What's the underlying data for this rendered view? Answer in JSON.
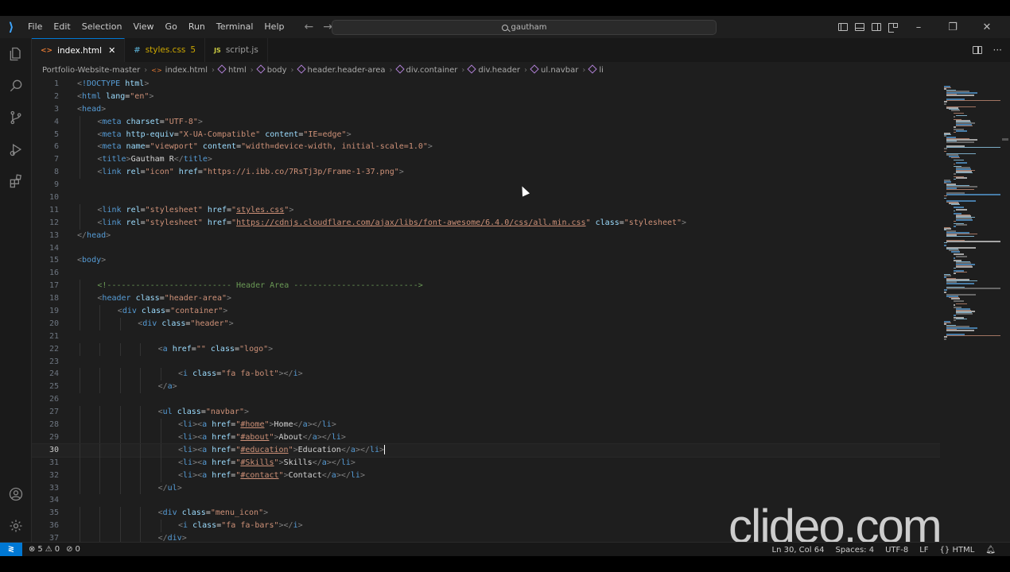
{
  "menu": [
    "File",
    "Edit",
    "Selection",
    "View",
    "Go",
    "Run",
    "Terminal",
    "Help"
  ],
  "search": {
    "text": "gautham"
  },
  "tabs": [
    {
      "icon": "<>",
      "label": "index.html",
      "modified": "",
      "active": true
    },
    {
      "icon": "#",
      "label": "styles.css",
      "modified": "5",
      "active": false
    },
    {
      "icon": "JS",
      "label": "script.js",
      "modified": "",
      "active": false
    }
  ],
  "breadcrumb": [
    "Portfolio-Website-master",
    "index.html",
    "html",
    "body",
    "header.header-area",
    "div.container",
    "div.header",
    "ul.navbar",
    "li"
  ],
  "current_line": 30,
  "code_lines": [
    {
      "n": 1,
      "indent": 0,
      "parts": [
        [
          "p",
          "<"
        ],
        [
          "t",
          "!DOCTYPE"
        ],
        [
          "x",
          " "
        ],
        [
          "a",
          "html"
        ],
        [
          "p",
          ">"
        ]
      ]
    },
    {
      "n": 2,
      "indent": 0,
      "parts": [
        [
          "p",
          "<"
        ],
        [
          "t",
          "html"
        ],
        [
          "x",
          " "
        ],
        [
          "a",
          "lang"
        ],
        [
          "x",
          "="
        ],
        [
          "s",
          "\"en\""
        ],
        [
          "p",
          ">"
        ]
      ]
    },
    {
      "n": 3,
      "indent": 0,
      "parts": [
        [
          "p",
          "<"
        ],
        [
          "t",
          "head"
        ],
        [
          "p",
          ">"
        ]
      ]
    },
    {
      "n": 4,
      "indent": 1,
      "parts": [
        [
          "p",
          "<"
        ],
        [
          "t",
          "meta"
        ],
        [
          "x",
          " "
        ],
        [
          "a",
          "charset"
        ],
        [
          "x",
          "="
        ],
        [
          "s",
          "\"UTF-8\""
        ],
        [
          "p",
          ">"
        ]
      ]
    },
    {
      "n": 5,
      "indent": 1,
      "parts": [
        [
          "p",
          "<"
        ],
        [
          "t",
          "meta"
        ],
        [
          "x",
          " "
        ],
        [
          "a",
          "http-equiv"
        ],
        [
          "x",
          "="
        ],
        [
          "s",
          "\"X-UA-Compatible\""
        ],
        [
          "x",
          " "
        ],
        [
          "a",
          "content"
        ],
        [
          "x",
          "="
        ],
        [
          "s",
          "\"IE=edge\""
        ],
        [
          "p",
          ">"
        ]
      ]
    },
    {
      "n": 6,
      "indent": 1,
      "parts": [
        [
          "p",
          "<"
        ],
        [
          "t",
          "meta"
        ],
        [
          "x",
          " "
        ],
        [
          "a",
          "name"
        ],
        [
          "x",
          "="
        ],
        [
          "s",
          "\"viewport\""
        ],
        [
          "x",
          " "
        ],
        [
          "a",
          "content"
        ],
        [
          "x",
          "="
        ],
        [
          "s",
          "\"width=device-width, initial-scale=1.0\""
        ],
        [
          "p",
          ">"
        ]
      ]
    },
    {
      "n": 7,
      "indent": 1,
      "parts": [
        [
          "p",
          "<"
        ],
        [
          "t",
          "title"
        ],
        [
          "p",
          ">"
        ],
        [
          "x",
          "Gautham R"
        ],
        [
          "p",
          "</"
        ],
        [
          "t",
          "title"
        ],
        [
          "p",
          ">"
        ]
      ]
    },
    {
      "n": 8,
      "indent": 1,
      "parts": [
        [
          "p",
          "<"
        ],
        [
          "t",
          "link"
        ],
        [
          "x",
          " "
        ],
        [
          "a",
          "rel"
        ],
        [
          "x",
          "="
        ],
        [
          "s",
          "\"icon\""
        ],
        [
          "x",
          " "
        ],
        [
          "a",
          "href"
        ],
        [
          "x",
          "="
        ],
        [
          "s",
          "\"https://i.ibb.co/7RsTj3p/Frame-1-37.png\""
        ],
        [
          "p",
          ">"
        ]
      ]
    },
    {
      "n": 9,
      "indent": 0,
      "parts": []
    },
    {
      "n": 10,
      "indent": 0,
      "parts": []
    },
    {
      "n": 11,
      "indent": 1,
      "parts": [
        [
          "p",
          "<"
        ],
        [
          "t",
          "link"
        ],
        [
          "x",
          " "
        ],
        [
          "a",
          "rel"
        ],
        [
          "x",
          "="
        ],
        [
          "s",
          "\"stylesheet\""
        ],
        [
          "x",
          " "
        ],
        [
          "a",
          "href"
        ],
        [
          "x",
          "="
        ],
        [
          "s",
          "\""
        ],
        [
          "u",
          "styles.css"
        ],
        [
          "s",
          "\""
        ],
        [
          "p",
          ">"
        ]
      ]
    },
    {
      "n": 12,
      "indent": 1,
      "parts": [
        [
          "p",
          "<"
        ],
        [
          "t",
          "link"
        ],
        [
          "x",
          " "
        ],
        [
          "a",
          "rel"
        ],
        [
          "x",
          "="
        ],
        [
          "s",
          "\"stylesheet\""
        ],
        [
          "x",
          " "
        ],
        [
          "a",
          "href"
        ],
        [
          "x",
          "="
        ],
        [
          "s",
          "\""
        ],
        [
          "u",
          "https://cdnjs.cloudflare.com/ajax/libs/font-awesome/6.4.0/css/all.min.css"
        ],
        [
          "s",
          "\""
        ],
        [
          "x",
          " "
        ],
        [
          "a",
          "class"
        ],
        [
          "x",
          "="
        ],
        [
          "s",
          "\"stylesheet\""
        ],
        [
          "p",
          ">"
        ]
      ]
    },
    {
      "n": 13,
      "indent": 0,
      "parts": [
        [
          "p",
          "</"
        ],
        [
          "t",
          "head"
        ],
        [
          "p",
          ">"
        ]
      ]
    },
    {
      "n": 14,
      "indent": 0,
      "parts": []
    },
    {
      "n": 15,
      "indent": 0,
      "parts": [
        [
          "p",
          "<"
        ],
        [
          "t",
          "body"
        ],
        [
          "p",
          ">"
        ]
      ]
    },
    {
      "n": 16,
      "indent": 0,
      "parts": []
    },
    {
      "n": 17,
      "indent": 1,
      "parts": [
        [
          "c",
          "<!-------------------------- Header Area -------------------------->"
        ]
      ]
    },
    {
      "n": 18,
      "indent": 1,
      "parts": [
        [
          "p",
          "<"
        ],
        [
          "t",
          "header"
        ],
        [
          "x",
          " "
        ],
        [
          "a",
          "class"
        ],
        [
          "x",
          "="
        ],
        [
          "s",
          "\"header-area\""
        ],
        [
          "p",
          ">"
        ]
      ]
    },
    {
      "n": 19,
      "indent": 2,
      "parts": [
        [
          "p",
          "<"
        ],
        [
          "t",
          "div"
        ],
        [
          "x",
          " "
        ],
        [
          "a",
          "class"
        ],
        [
          "x",
          "="
        ],
        [
          "s",
          "\"container\""
        ],
        [
          "p",
          ">"
        ]
      ]
    },
    {
      "n": 20,
      "indent": 3,
      "parts": [
        [
          "p",
          "<"
        ],
        [
          "t",
          "div"
        ],
        [
          "x",
          " "
        ],
        [
          "a",
          "class"
        ],
        [
          "x",
          "="
        ],
        [
          "s",
          "\"header\""
        ],
        [
          "p",
          ">"
        ]
      ]
    },
    {
      "n": 21,
      "indent": 0,
      "parts": []
    },
    {
      "n": 22,
      "indent": 4,
      "parts": [
        [
          "p",
          "<"
        ],
        [
          "t",
          "a"
        ],
        [
          "x",
          " "
        ],
        [
          "a",
          "href"
        ],
        [
          "x",
          "="
        ],
        [
          "s",
          "\"\""
        ],
        [
          "x",
          " "
        ],
        [
          "a",
          "class"
        ],
        [
          "x",
          "="
        ],
        [
          "s",
          "\"logo\""
        ],
        [
          "p",
          ">"
        ]
      ]
    },
    {
      "n": 23,
      "indent": 0,
      "parts": []
    },
    {
      "n": 24,
      "indent": 5,
      "parts": [
        [
          "p",
          "<"
        ],
        [
          "t",
          "i"
        ],
        [
          "x",
          " "
        ],
        [
          "a",
          "class"
        ],
        [
          "x",
          "="
        ],
        [
          "s",
          "\"fa fa-bolt\""
        ],
        [
          "p",
          ">"
        ],
        [
          "p",
          "</"
        ],
        [
          "t",
          "i"
        ],
        [
          "p",
          ">"
        ]
      ]
    },
    {
      "n": 25,
      "indent": 4,
      "parts": [
        [
          "p",
          "</"
        ],
        [
          "t",
          "a"
        ],
        [
          "p",
          ">"
        ]
      ]
    },
    {
      "n": 26,
      "indent": 0,
      "parts": []
    },
    {
      "n": 27,
      "indent": 4,
      "parts": [
        [
          "p",
          "<"
        ],
        [
          "t",
          "ul"
        ],
        [
          "x",
          " "
        ],
        [
          "a",
          "class"
        ],
        [
          "x",
          "="
        ],
        [
          "s",
          "\"navbar\""
        ],
        [
          "p",
          ">"
        ]
      ]
    },
    {
      "n": 28,
      "indent": 5,
      "parts": [
        [
          "p",
          "<"
        ],
        [
          "t",
          "li"
        ],
        [
          "p",
          ">"
        ],
        [
          "p",
          "<"
        ],
        [
          "t",
          "a"
        ],
        [
          "x",
          " "
        ],
        [
          "a",
          "href"
        ],
        [
          "x",
          "="
        ],
        [
          "s",
          "\""
        ],
        [
          "u",
          "#home"
        ],
        [
          "s",
          "\""
        ],
        [
          "p",
          ">"
        ],
        [
          "x",
          "Home"
        ],
        [
          "p",
          "</"
        ],
        [
          "t",
          "a"
        ],
        [
          "p",
          ">"
        ],
        [
          "p",
          "</"
        ],
        [
          "t",
          "li"
        ],
        [
          "p",
          ">"
        ]
      ]
    },
    {
      "n": 29,
      "indent": 5,
      "parts": [
        [
          "p",
          "<"
        ],
        [
          "t",
          "li"
        ],
        [
          "p",
          ">"
        ],
        [
          "p",
          "<"
        ],
        [
          "t",
          "a"
        ],
        [
          "x",
          " "
        ],
        [
          "a",
          "href"
        ],
        [
          "x",
          "="
        ],
        [
          "s",
          "\""
        ],
        [
          "u",
          "#about"
        ],
        [
          "s",
          "\""
        ],
        [
          "p",
          ">"
        ],
        [
          "x",
          "About"
        ],
        [
          "p",
          "</"
        ],
        [
          "t",
          "a"
        ],
        [
          "p",
          ">"
        ],
        [
          "p",
          "</"
        ],
        [
          "t",
          "li"
        ],
        [
          "p",
          ">"
        ]
      ]
    },
    {
      "n": 30,
      "indent": 5,
      "parts": [
        [
          "p",
          "<"
        ],
        [
          "t",
          "li"
        ],
        [
          "p",
          ">"
        ],
        [
          "p",
          "<"
        ],
        [
          "t",
          "a"
        ],
        [
          "x",
          " "
        ],
        [
          "a",
          "href"
        ],
        [
          "x",
          "="
        ],
        [
          "s",
          "\""
        ],
        [
          "u",
          "#education"
        ],
        [
          "s",
          "\""
        ],
        [
          "p",
          ">"
        ],
        [
          "x",
          "Education"
        ],
        [
          "p",
          "</"
        ],
        [
          "t",
          "a"
        ],
        [
          "p",
          ">"
        ],
        [
          "p",
          "</"
        ],
        [
          "t",
          "li"
        ],
        [
          "p",
          ">"
        ]
      ]
    },
    {
      "n": 31,
      "indent": 5,
      "parts": [
        [
          "p",
          "<"
        ],
        [
          "t",
          "li"
        ],
        [
          "p",
          ">"
        ],
        [
          "p",
          "<"
        ],
        [
          "t",
          "a"
        ],
        [
          "x",
          " "
        ],
        [
          "a",
          "href"
        ],
        [
          "x",
          "="
        ],
        [
          "s",
          "\""
        ],
        [
          "u",
          "#Skills"
        ],
        [
          "s",
          "\""
        ],
        [
          "p",
          ">"
        ],
        [
          "x",
          "Skills"
        ],
        [
          "p",
          "</"
        ],
        [
          "t",
          "a"
        ],
        [
          "p",
          ">"
        ],
        [
          "p",
          "</"
        ],
        [
          "t",
          "li"
        ],
        [
          "p",
          ">"
        ]
      ]
    },
    {
      "n": 32,
      "indent": 5,
      "parts": [
        [
          "p",
          "<"
        ],
        [
          "t",
          "li"
        ],
        [
          "p",
          ">"
        ],
        [
          "p",
          "<"
        ],
        [
          "t",
          "a"
        ],
        [
          "x",
          " "
        ],
        [
          "a",
          "href"
        ],
        [
          "x",
          "="
        ],
        [
          "s",
          "\""
        ],
        [
          "u",
          "#contact"
        ],
        [
          "s",
          "\""
        ],
        [
          "p",
          ">"
        ],
        [
          "x",
          "Contact"
        ],
        [
          "p",
          "</"
        ],
        [
          "t",
          "a"
        ],
        [
          "p",
          ">"
        ],
        [
          "p",
          "</"
        ],
        [
          "t",
          "li"
        ],
        [
          "p",
          ">"
        ]
      ]
    },
    {
      "n": 33,
      "indent": 4,
      "parts": [
        [
          "p",
          "</"
        ],
        [
          "t",
          "ul"
        ],
        [
          "p",
          ">"
        ]
      ]
    },
    {
      "n": 34,
      "indent": 0,
      "parts": []
    },
    {
      "n": 35,
      "indent": 4,
      "parts": [
        [
          "p",
          "<"
        ],
        [
          "t",
          "div"
        ],
        [
          "x",
          " "
        ],
        [
          "a",
          "class"
        ],
        [
          "x",
          "="
        ],
        [
          "s",
          "\"menu_icon\""
        ],
        [
          "p",
          ">"
        ]
      ]
    },
    {
      "n": 36,
      "indent": 5,
      "parts": [
        [
          "p",
          "<"
        ],
        [
          "t",
          "i"
        ],
        [
          "x",
          " "
        ],
        [
          "a",
          "class"
        ],
        [
          "x",
          "="
        ],
        [
          "s",
          "\"fa fa-bars\""
        ],
        [
          "p",
          ">"
        ],
        [
          "p",
          "</"
        ],
        [
          "t",
          "i"
        ],
        [
          "p",
          ">"
        ]
      ]
    },
    {
      "n": 37,
      "indent": 4,
      "parts": [
        [
          "p",
          "</"
        ],
        [
          "t",
          "div"
        ],
        [
          "p",
          ">"
        ]
      ]
    }
  ],
  "status": {
    "errors": "5",
    "warnings": "0",
    "ports": "0",
    "position": "Ln 30, Col 64",
    "spaces": "Spaces: 4",
    "encoding": "UTF-8",
    "eol": "LF",
    "language": "HTML"
  },
  "watermark": "clideo.com",
  "colors": {
    "accent": "#0078d4",
    "tag": "#569cd6",
    "attr": "#9cdcfe",
    "string": "#ce9178",
    "comment": "#6a9955"
  }
}
